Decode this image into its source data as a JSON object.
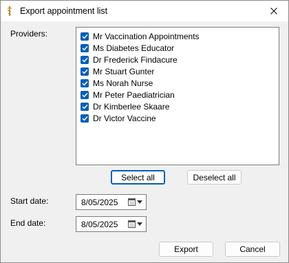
{
  "window": {
    "title": "Export appointment list",
    "icons": {
      "app": "caduceus-icon",
      "close": "close-icon"
    }
  },
  "providers_label": "Providers:",
  "providers": [
    {
      "label": "Mr Vaccination Appointments",
      "checked": true
    },
    {
      "label": "Ms Diabetes Educator",
      "checked": true
    },
    {
      "label": "Dr Frederick Findacure",
      "checked": true
    },
    {
      "label": "Mr Stuart Gunter",
      "checked": true
    },
    {
      "label": "Ms Norah Nurse",
      "checked": true
    },
    {
      "label": "Mr Peter Paediatrician",
      "checked": true
    },
    {
      "label": "Dr Kimberlee Skaare",
      "checked": true
    },
    {
      "label": "Dr Victor Vaccine",
      "checked": true
    }
  ],
  "buttons": {
    "select_all": "Select all",
    "deselect_all": "Deselect all",
    "export": "Export",
    "cancel": "Cancel"
  },
  "start_date": {
    "label": "Start date:",
    "value": "8/05/2025"
  },
  "end_date": {
    "label": "End date:",
    "value": "8/05/2025"
  },
  "colors": {
    "accent": "#005fb8",
    "titlebar": "#ffffff",
    "window": "#f0f0f0"
  }
}
